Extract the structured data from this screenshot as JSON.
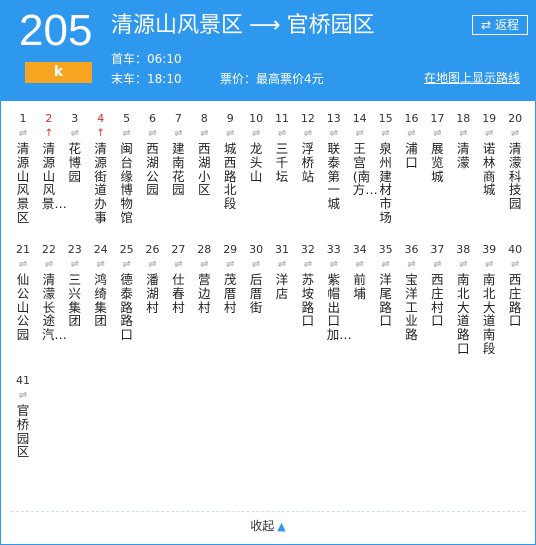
{
  "route": {
    "number": "205",
    "tag": "k",
    "origin": "清源山风景区",
    "arrow": "⟶",
    "destination": "官桥园区",
    "return_label": "返程",
    "first_bus_label": "首车：",
    "first_bus_time": "06:10",
    "last_bus_label": "末车：",
    "last_bus_time": "18:10",
    "fare_label": "票价：",
    "fare_value": "最高票价4元",
    "map_link": "在地图上显示路线"
  },
  "stops": [
    {
      "num": "1",
      "name": "清源山风景区"
    },
    {
      "num": "2",
      "name": "清源山风景…",
      "active": true
    },
    {
      "num": "3",
      "name": "花博园"
    },
    {
      "num": "4",
      "name": "清源街道办事",
      "active": true
    },
    {
      "num": "5",
      "name": "闽台缘博物馆"
    },
    {
      "num": "6",
      "name": "西湖公园"
    },
    {
      "num": "7",
      "name": "建南花园"
    },
    {
      "num": "8",
      "name": "西湖小区"
    },
    {
      "num": "9",
      "name": "城西路北段"
    },
    {
      "num": "10",
      "name": "龙头山"
    },
    {
      "num": "11",
      "name": "三千坛"
    },
    {
      "num": "12",
      "name": "浮桥站"
    },
    {
      "num": "13",
      "name": "联泰第一城"
    },
    {
      "num": "14",
      "name": "王宫(南方…"
    },
    {
      "num": "15",
      "name": "泉州建材市场"
    },
    {
      "num": "16",
      "name": "浦口"
    },
    {
      "num": "17",
      "name": "展览城"
    },
    {
      "num": "18",
      "name": "清濛"
    },
    {
      "num": "19",
      "name": "诺林商城"
    },
    {
      "num": "20",
      "name": "清濛科技园"
    },
    {
      "num": "21",
      "name": "仙公山公园"
    },
    {
      "num": "22",
      "name": "清濛长途汽…"
    },
    {
      "num": "23",
      "name": "三兴集团"
    },
    {
      "num": "24",
      "name": "鸿绮集团"
    },
    {
      "num": "25",
      "name": "德泰路路口"
    },
    {
      "num": "26",
      "name": "潘湖村"
    },
    {
      "num": "27",
      "name": "仕春村"
    },
    {
      "num": "28",
      "name": "营边村"
    },
    {
      "num": "29",
      "name": "茂厝村"
    },
    {
      "num": "30",
      "name": "后厝街"
    },
    {
      "num": "31",
      "name": "洋店"
    },
    {
      "num": "32",
      "name": "苏垵路口"
    },
    {
      "num": "33",
      "name": "紫帽出口加…"
    },
    {
      "num": "34",
      "name": "前埔"
    },
    {
      "num": "35",
      "name": "洋尾路口"
    },
    {
      "num": "36",
      "name": "宝洋工业路"
    },
    {
      "num": "37",
      "name": "西庄村口"
    },
    {
      "num": "38",
      "name": "南北大道路口"
    },
    {
      "num": "39",
      "name": "南北大道南段"
    },
    {
      "num": "40",
      "name": "西庄路口"
    },
    {
      "num": "41",
      "name": "官桥园区"
    }
  ],
  "icons": {
    "bidirectional": "⇌",
    "bus_arrival": "↑",
    "swap": "⇄",
    "chevron_up": "▲"
  },
  "footer": {
    "collapse_label": "收起"
  },
  "colors": {
    "accent": "#2e97ee",
    "tag": "#f7a421",
    "active": "#e8262c"
  }
}
